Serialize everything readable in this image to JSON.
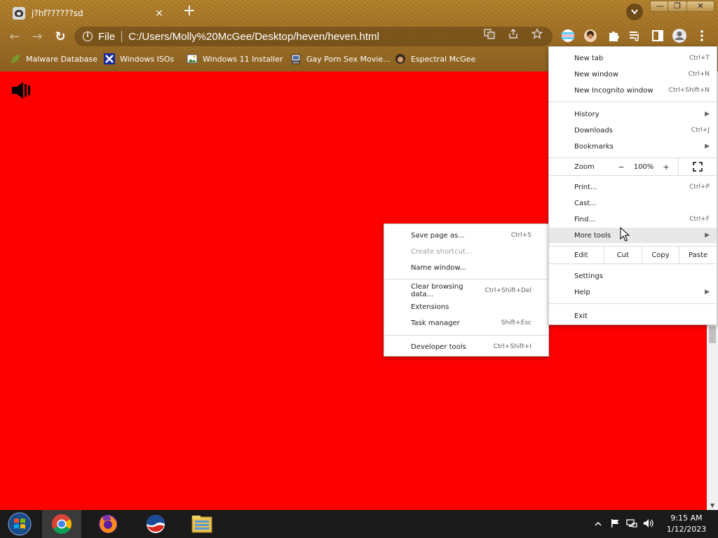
{
  "tab": {
    "title": "j?hf??????sd",
    "close_glyph": "×",
    "new_tab_glyph": "+"
  },
  "window_controls": {
    "minimize": "—",
    "restore": "❐",
    "close": "✕"
  },
  "toolbar": {
    "back_glyph": "←",
    "forward_glyph": "→",
    "reload_glyph": "↻",
    "scheme_label": "File",
    "url": "C:/Users/Molly%20McGee/Desktop/heven/heven.html"
  },
  "bookmarks": [
    {
      "label": "Malware Database",
      "icon": "leaf-icon"
    },
    {
      "label": "Windows ISOs",
      "icon": "x-logo-icon"
    },
    {
      "label": "Windows 11 Installer",
      "icon": "image-icon"
    },
    {
      "label": "Gay Porn Sex Movie...",
      "icon": "pc-icon"
    },
    {
      "label": "Espectral McGee",
      "icon": "avatar-icon"
    }
  ],
  "main_menu": {
    "new_tab": {
      "label": "New tab",
      "shortcut": "Ctrl+T"
    },
    "new_window": {
      "label": "New window",
      "shortcut": "Ctrl+N"
    },
    "new_incognito": {
      "label": "New Incognito window",
      "shortcut": "Ctrl+Shift+N"
    },
    "history": {
      "label": "History"
    },
    "downloads": {
      "label": "Downloads",
      "shortcut": "Ctrl+J"
    },
    "bookmarks": {
      "label": "Bookmarks"
    },
    "zoom": {
      "label": "Zoom",
      "minus": "−",
      "value": "100%",
      "plus": "+"
    },
    "print": {
      "label": "Print...",
      "shortcut": "Ctrl+P"
    },
    "cast": {
      "label": "Cast..."
    },
    "find": {
      "label": "Find...",
      "shortcut": "Ctrl+F"
    },
    "more_tools": {
      "label": "More tools"
    },
    "edit": {
      "label": "Edit",
      "cut": "Cut",
      "copy": "Copy",
      "paste": "Paste"
    },
    "settings": {
      "label": "Settings"
    },
    "help": {
      "label": "Help"
    },
    "exit": {
      "label": "Exit"
    },
    "submenu_arrow": "▶"
  },
  "more_tools_menu": {
    "save_page": {
      "label": "Save page as...",
      "shortcut": "Ctrl+S"
    },
    "create_shortcut": {
      "label": "Create shortcut..."
    },
    "name_window": {
      "label": "Name window..."
    },
    "clear_data": {
      "label": "Clear browsing data...",
      "shortcut": "Ctrl+Shift+Del"
    },
    "extensions": {
      "label": "Extensions"
    },
    "task_manager": {
      "label": "Task manager",
      "shortcut": "Shift+Esc"
    },
    "dev_tools": {
      "label": "Developer tools",
      "shortcut": "Ctrl+Shift+I"
    }
  },
  "taskbar": {
    "apps": [
      "start-icon",
      "chrome-icon",
      "firefox-icon",
      "obama-logo-icon",
      "file-explorer-icon"
    ],
    "clock_time": "9:15 AM",
    "clock_date": "1/12/2023"
  },
  "colors": {
    "page_background": "#ff0000",
    "chrome_theme": "#a8772a",
    "taskbar": "#1a1a1a"
  }
}
